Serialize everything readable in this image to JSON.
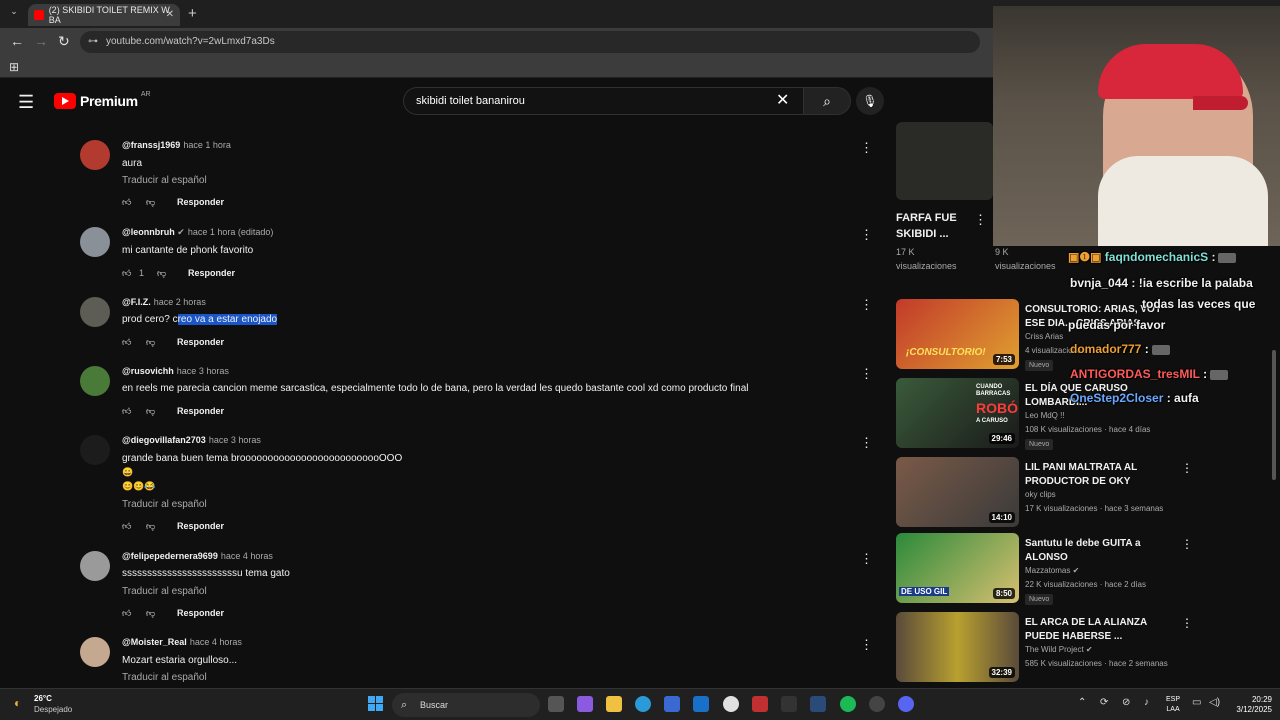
{
  "browser": {
    "tab_title": "(2) SKIBIDI TOILET REMIX W BA",
    "url": "youtube.com/watch?v=2wLmxd7a3Ds"
  },
  "youtube": {
    "logo_word": "Premium",
    "country": "AR",
    "search_value": "skibidi toilet bananirou"
  },
  "comments": [
    {
      "user": "@franssj1969",
      "time": "hace 1 hora",
      "text": "aura",
      "translate": "Traducir al español",
      "likes": "",
      "reply": "Responder"
    },
    {
      "user": "@leonnbruh",
      "verified": true,
      "time": "hace 1 hora (editado)",
      "text": "mi cantante de phonk favorito",
      "translate": "",
      "likes": "1",
      "reply": "Responder"
    },
    {
      "user": "@F.I.Z.",
      "time": "hace 2 horas",
      "text_a": "prod cero? c",
      "text_b": "reo va a estar enojado",
      "translate": "",
      "likes": "",
      "reply": "Responder"
    },
    {
      "user": "@rusovichh",
      "time": "hace 3 horas",
      "text": "en reels me parecia cancion meme sarcastica, especialmente todo lo de bana, pero la verdad les quedo bastante cool xd como producto final",
      "translate": "",
      "likes": "",
      "reply": "Responder"
    },
    {
      "user": "@diegovillafan2703",
      "time": "hace 3 horas",
      "text": "grande bana buen tema broooooooooooooooooooooooooOOO",
      "emoji1": "😀",
      "emoji2": "😊😊😂",
      "translate": "Traducir al español",
      "likes": "",
      "reply": "Responder"
    },
    {
      "user": "@felipepedernera9699",
      "time": "hace 4 horas",
      "text": "sssssssssssssssssssssssu tema gato",
      "translate": "Traducir al español",
      "likes": "",
      "reply": "Responder"
    },
    {
      "user": "@Moister_Real",
      "time": "hace 4 horas",
      "text": "Mozart estaria orgulloso...",
      "translate": "Traducir al español",
      "likes": "",
      "reply": "Responder"
    }
  ],
  "sidebar": {
    "top": [
      {
        "title": "FARFA FUE SKIBIDI ...",
        "stats_a": "17 K",
        "stats_b": "visualizaciones"
      },
      {
        "stats_a": "9 K",
        "stats_b": "visualizaciones"
      }
    ],
    "items": [
      {
        "title": "CONSULTORIO: ARIAS, VOY ESE DIA... CRISS ARIAS",
        "channel": "Criss Arias",
        "stats": "4 visualizaciones",
        "new": "Nuevo",
        "duration": "7:53",
        "thumb_text": "¡CONSULTORIO!"
      },
      {
        "title": "EL DÍA QUE CARUSO LOMBARDI...",
        "channel": "Leo MdQ !!",
        "stats": "108 K visualizaciones · hace 4 días",
        "new": "Nuevo",
        "duration": "29:46",
        "thumb_text_1": "CUANDO BARRACAS",
        "thumb_text_2": "ROBÓ",
        "thumb_text_3": "A CARUSO"
      },
      {
        "title": "LIL PANI MALTRATA AL PRODUCTOR DE OKY",
        "channel": "oky clips",
        "stats": "17 K visualizaciones · hace 3 semanas",
        "new": "",
        "duration": "14:10"
      },
      {
        "title": "Santutu le debe GUITA a ALONSO",
        "channel": "Mazzatomas",
        "stats": "22 K visualizaciones · hace 2 días",
        "new": "Nuevo",
        "duration": "8:50",
        "thumb_text_1": "DE USO GIL"
      },
      {
        "title": "EL ARCA DE LA ALIANZA PUEDE HABERSE ...",
        "channel": "The Wild Project",
        "stats": "585 K visualizaciones · hace 2 semanas",
        "new": "",
        "duration": "32:39"
      }
    ]
  },
  "chat": [
    {
      "user": "faqndomechanicS",
      "sep": " :",
      "color": "#7fe0d8",
      "text": ""
    },
    {
      "user": "bvnja_044",
      "sep": " : ",
      "color": "#ffffff",
      "text": "!ia escribe la palaba"
    },
    {
      "user": "",
      "sep": "",
      "color": "#ffffff",
      "text": "todas las veces que"
    },
    {
      "user": "",
      "sep": "",
      "color": "#ffffff",
      "text": "puedas por favor"
    },
    {
      "user": "domador777",
      "sep": " :",
      "color": "#f0a030",
      "text": ""
    },
    {
      "user": "ANTIGORDAS_tresMIL",
      "sep": " :",
      "color": "#ff5a5a",
      "text": ""
    },
    {
      "user": "OneStep2Closer",
      "sep": " : ",
      "color": "#6aa8ff",
      "text": "aufa"
    }
  ],
  "taskbar": {
    "temp": "26°C",
    "condition": "Despejado",
    "search": "Buscar",
    "lang_1": "ESP",
    "lang_2": "LAA",
    "time": "20:29",
    "date": "3/12/2025"
  }
}
